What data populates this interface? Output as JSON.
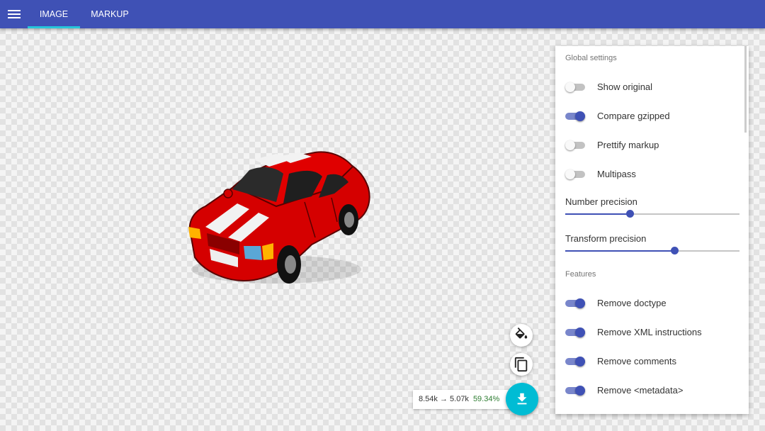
{
  "tabs": [
    {
      "label": "IMAGE",
      "active": true
    },
    {
      "label": "MARKUP",
      "active": false
    }
  ],
  "icons": {
    "menu": "menu-icon",
    "paint": "format-paint-icon",
    "copy": "copy-icon",
    "download": "download-icon"
  },
  "settings": {
    "global_title": "Global settings",
    "toggles": [
      {
        "label": "Show original",
        "on": false
      },
      {
        "label": "Compare gzipped",
        "on": true
      },
      {
        "label": "Prettify markup",
        "on": false
      },
      {
        "label": "Multipass",
        "on": false
      }
    ],
    "sliders": [
      {
        "label": "Number precision",
        "fraction": 0.37
      },
      {
        "label": "Transform precision",
        "fraction": 0.625
      }
    ],
    "features_title": "Features",
    "features": [
      {
        "label": "Remove doctype",
        "on": true
      },
      {
        "label": "Remove XML instructions",
        "on": true
      },
      {
        "label": "Remove comments",
        "on": true
      },
      {
        "label": "Remove <metadata>",
        "on": true
      }
    ]
  },
  "stats": {
    "size_text": "8.54k → 5.07k",
    "percent": "59.34%"
  },
  "colors": {
    "topbar": "#3f51b5",
    "accent": "#3f51b5",
    "tab_indicator": "#26c6da",
    "download_fab": "#00bcd4",
    "savings_text": "#2e7d32"
  }
}
